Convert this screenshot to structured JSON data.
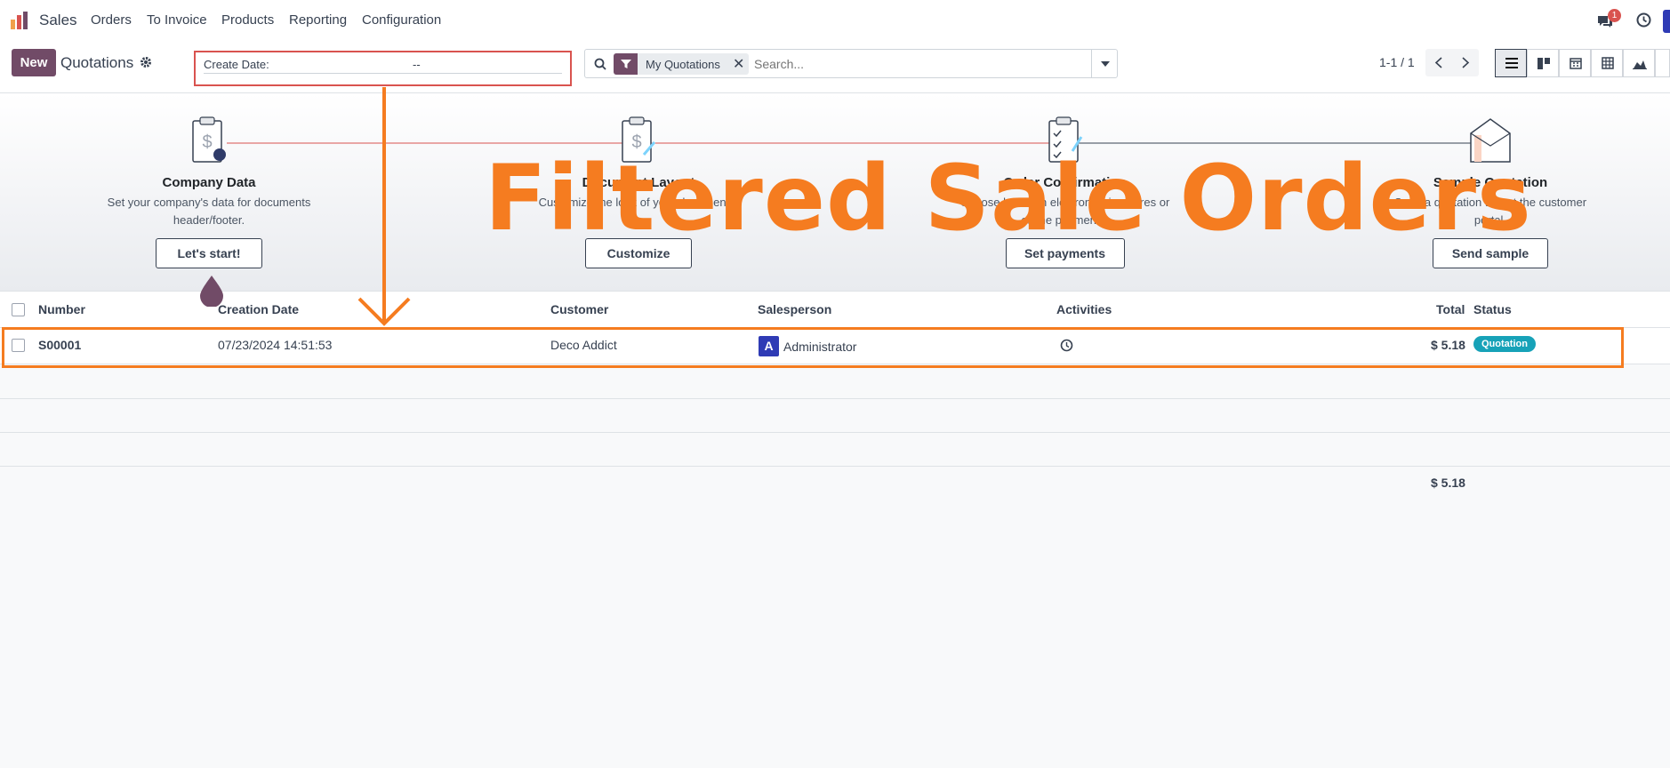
{
  "nav": {
    "app": "Sales",
    "items": [
      "Orders",
      "To Invoice",
      "Products",
      "Reporting",
      "Configuration"
    ],
    "messages_badge": "1"
  },
  "control": {
    "new_label": "New",
    "title": "Quotations",
    "create_date_label": "Create Date:",
    "create_date_value": "--",
    "filter_facet": "My Quotations",
    "search_placeholder": "Search...",
    "pager": "1-1 / 1"
  },
  "onboarding": [
    {
      "title": "Company Data",
      "desc1": "Set your company's data for documents",
      "desc2": "header/footer.",
      "button": "Let's start!"
    },
    {
      "title": "Document Layout",
      "desc1": "Customize the look of your documents.",
      "desc2": "",
      "button": "Customize"
    },
    {
      "title": "Order Confirmation",
      "desc1": "Choose between electronic signatures or",
      "desc2": "online payments.",
      "button": "Set payments"
    },
    {
      "title": "Sample Quotation",
      "desc1": "Send a quotation to test the customer",
      "desc2": "portal.",
      "button": "Send sample"
    }
  ],
  "table": {
    "headers": {
      "number": "Number",
      "creation_date": "Creation Date",
      "customer": "Customer",
      "salesperson": "Salesperson",
      "activities": "Activities",
      "total": "Total",
      "status": "Status"
    },
    "row": {
      "number": "S00001",
      "creation_date": "07/23/2024 14:51:53",
      "customer": "Deco Addict",
      "avatar": "A",
      "salesperson": "Administrator",
      "total": "$ 5.18",
      "status": "Quotation"
    },
    "footer_total": "$ 5.18"
  },
  "annotation": {
    "title": "Filtered Sale Orders"
  },
  "colors": {
    "brand": "#714b67",
    "annotation": "#f57c20",
    "highlight_red": "#d9534f",
    "status_badge": "#17a2b8",
    "avatar": "#2f3bb5"
  }
}
